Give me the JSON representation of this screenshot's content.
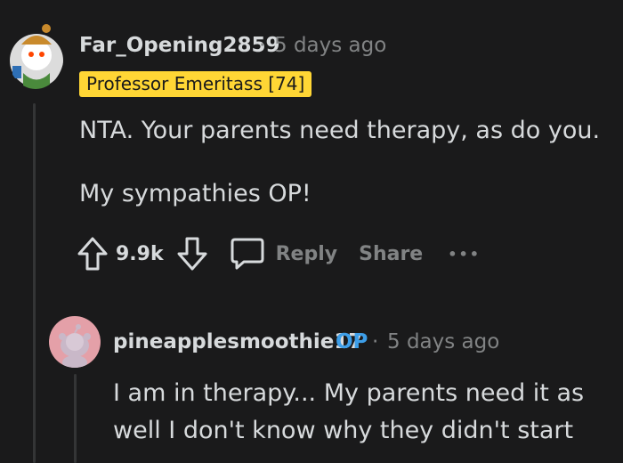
{
  "comment": {
    "username": "Far_Opening2859",
    "separator": "·",
    "timestamp": "5 days ago",
    "flair": "Professor Emeritass [74]",
    "paragraphs": [
      "NTA. Your parents need therapy, as do you.",
      "My sympathies OP!"
    ],
    "score": "9.9k",
    "reply_label": "Reply",
    "share_label": "Share",
    "more_label": "•••"
  },
  "reply": {
    "username": "pineapplesmoothie17",
    "op_tag": "OP",
    "separator": "·",
    "timestamp": "5 days ago",
    "lines": [
      "I am in therapy... My parents need it as",
      "well I don't know why they didn't start"
    ]
  },
  "colors": {
    "background": "#1a1a1b",
    "flair_bg": "#ffd635",
    "op_blue": "#3d9ee8",
    "meta_gray": "#818384"
  }
}
